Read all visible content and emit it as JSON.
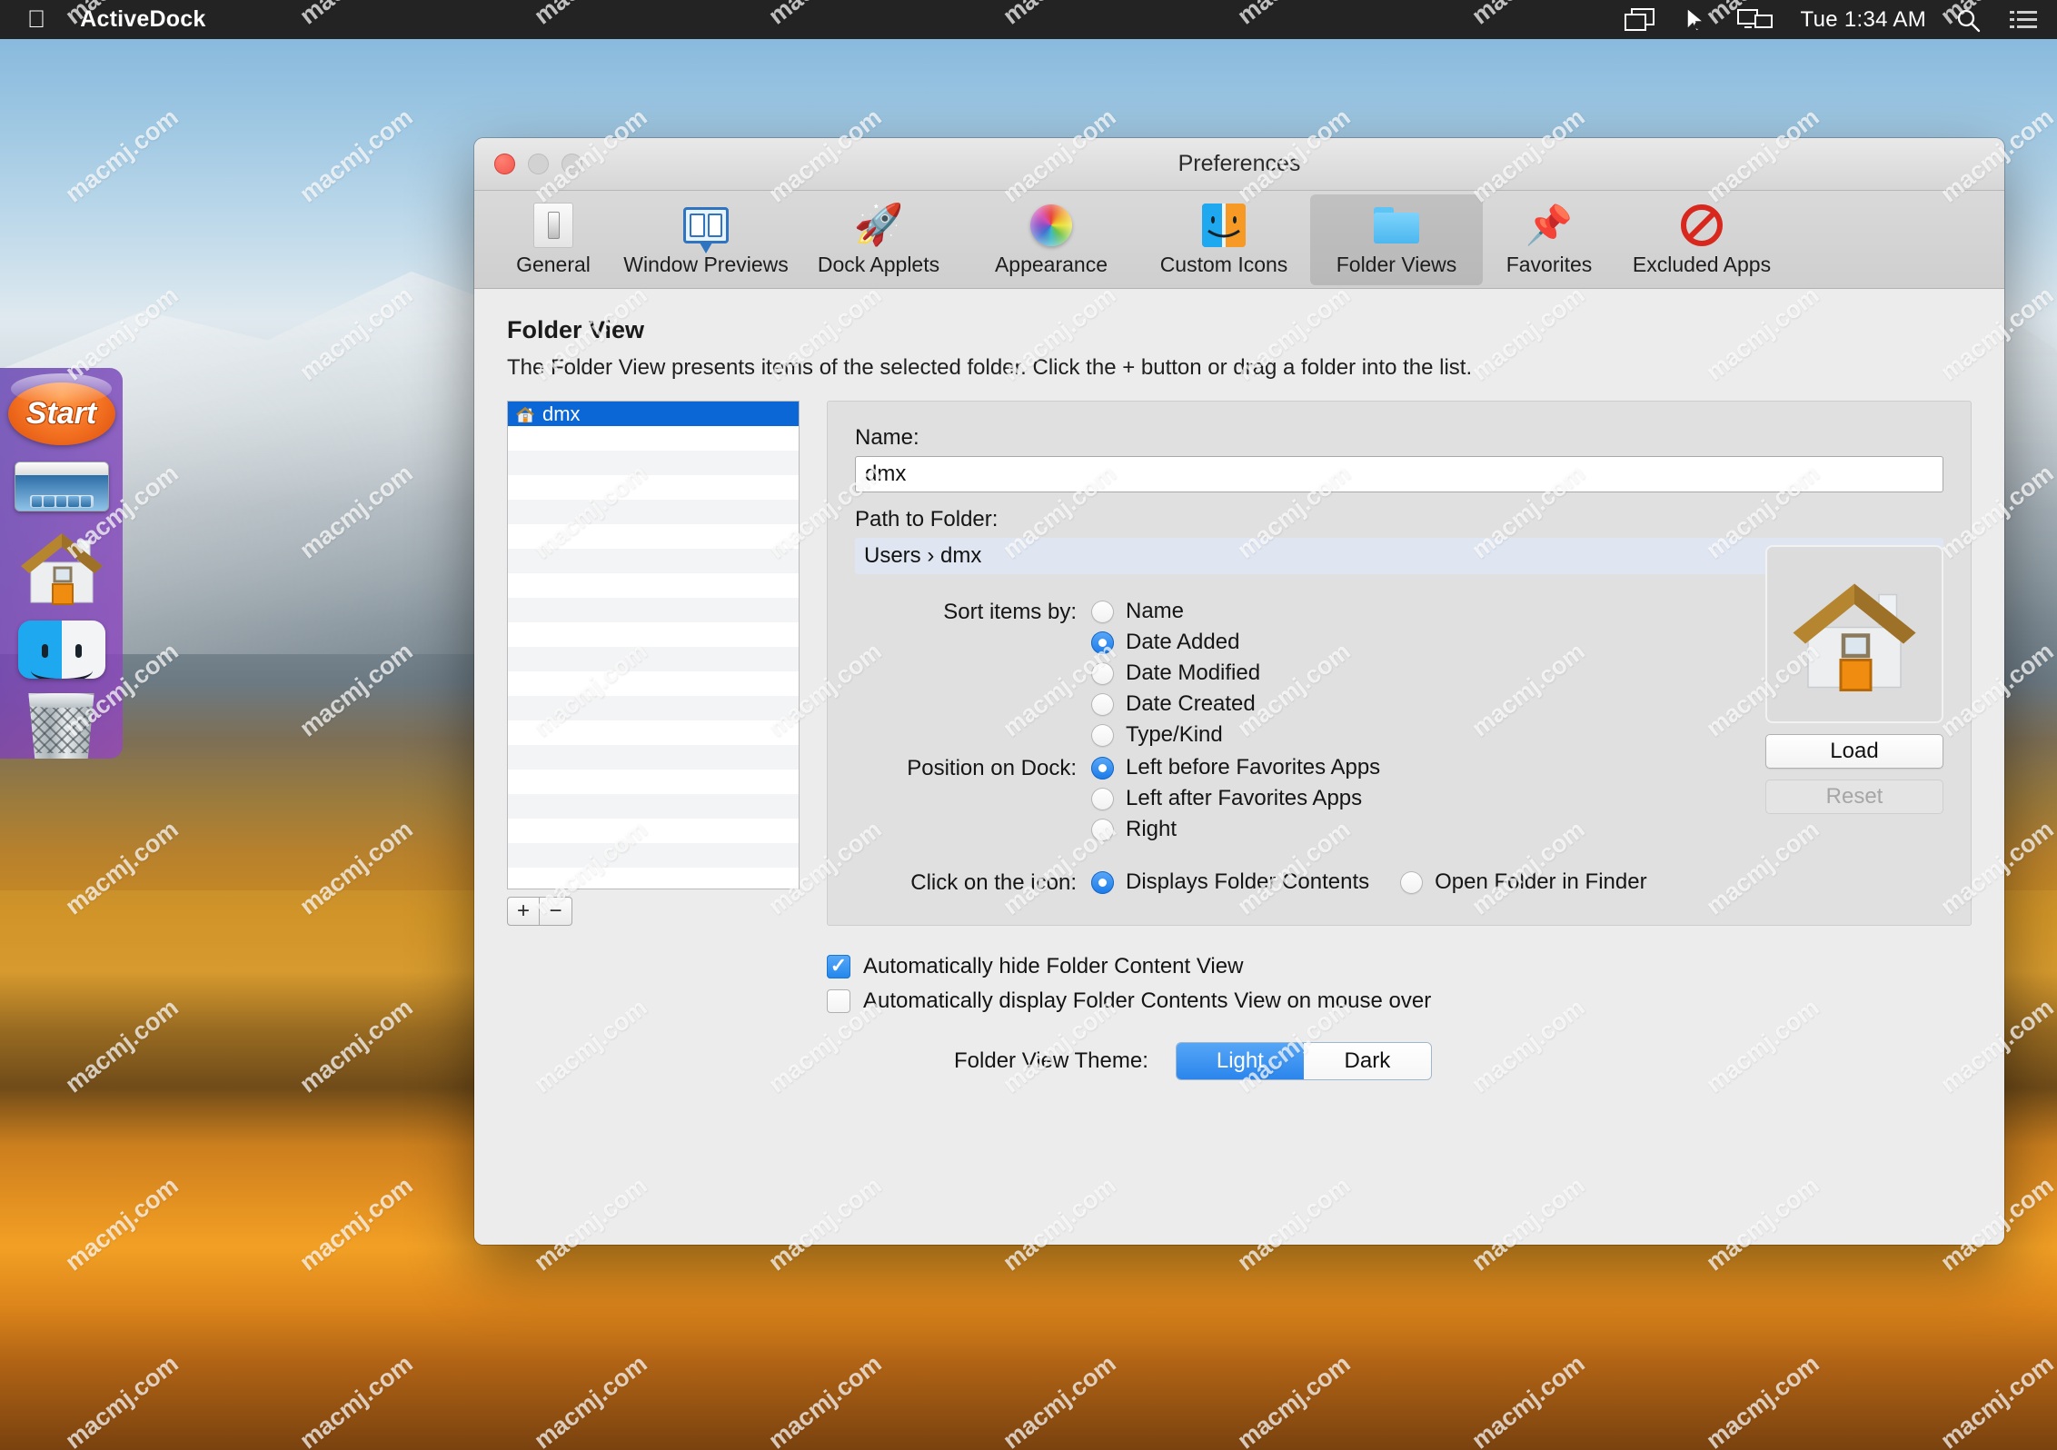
{
  "menubar": {
    "apple_glyph": "●",
    "app_title": "ActiveDock",
    "clock": "Tue 1:34 AM",
    "items": [
      {
        "name": "mission-control-icon",
        "label": ""
      },
      {
        "name": "cursor-icon",
        "label": ""
      },
      {
        "name": "display-icon",
        "label": ""
      },
      {
        "name": "search-icon",
        "label": ""
      },
      {
        "name": "notification-center-icon",
        "label": ""
      }
    ]
  },
  "dock": {
    "start_label": "Start",
    "items": [
      {
        "name": "start-button",
        "label": "Start"
      },
      {
        "name": "desktop-thumbnail-icon",
        "label": ""
      },
      {
        "name": "home-folder-icon",
        "label": ""
      },
      {
        "name": "finder-icon",
        "label": ""
      },
      {
        "name": "trash-icon",
        "label": ""
      }
    ]
  },
  "window": {
    "title": "Preferences",
    "traffic_lights": [
      "close",
      "minimize",
      "zoom"
    ]
  },
  "toolbar": {
    "items": [
      {
        "label": "General",
        "icon": "general-icon",
        "selected": false
      },
      {
        "label": "Window Previews",
        "icon": "window-previews-icon",
        "selected": false
      },
      {
        "label": "Dock Applets",
        "icon": "dock-applets-icon",
        "selected": false
      },
      {
        "label": "Appearance",
        "icon": "appearance-icon",
        "selected": false
      },
      {
        "label": "Custom Icons",
        "icon": "custom-icons-icon",
        "selected": false
      },
      {
        "label": "Folder Views",
        "icon": "folder-views-icon",
        "selected": true
      },
      {
        "label": "Favorites",
        "icon": "favorites-icon",
        "selected": false
      },
      {
        "label": "Excluded Apps",
        "icon": "excluded-apps-icon",
        "selected": false
      }
    ]
  },
  "section": {
    "title": "Folder View",
    "description": "The Folder View presents items of the selected folder. Click the + button or drag a folder into the list."
  },
  "folder_list": {
    "selected_index": 0,
    "rows": [
      {
        "label": "dmx",
        "icon": "home-folder-icon",
        "selected": true
      }
    ],
    "add_button": "+",
    "remove_button": "−"
  },
  "detail": {
    "name_label": "Name:",
    "name_value": "dmx",
    "path_label": "Path to Folder:",
    "path_value": "Users  ›  dmx",
    "sort_label": "Sort items by:",
    "sort_options": [
      {
        "label": "Name",
        "selected": false
      },
      {
        "label": "Date Added",
        "selected": true
      },
      {
        "label": "Date Modified",
        "selected": false
      },
      {
        "label": "Date Created",
        "selected": false
      },
      {
        "label": "Type/Kind",
        "selected": false
      }
    ],
    "position_label": "Position on Dock:",
    "position_options": [
      {
        "label": "Left before Favorites Apps",
        "selected": true
      },
      {
        "label": "Left after Favorites Apps",
        "selected": false
      },
      {
        "label": "Right",
        "selected": false
      }
    ],
    "click_label": "Click on the icon:",
    "click_options": [
      {
        "label": "Displays Folder Contents",
        "selected": true
      },
      {
        "label": "Open Folder in Finder",
        "selected": false
      }
    ],
    "preview_icon": "home-folder-icon",
    "load_button": "Load",
    "reset_button": "Reset",
    "reset_disabled": true
  },
  "bottom": {
    "checkboxes": [
      {
        "label": "Automatically hide Folder Content View",
        "checked": true
      },
      {
        "label": "Automatically display Folder Contents View on mouse over",
        "checked": false
      }
    ],
    "theme_label": "Folder View Theme:",
    "theme_options": [
      {
        "label": "Light",
        "selected": true
      },
      {
        "label": "Dark",
        "selected": false
      }
    ]
  },
  "colors": {
    "accent_blue": "#1b7ae8",
    "selection_blue": "#0b66d6",
    "window_bg": "#ececec",
    "detail_bg": "#e0e0e0",
    "menubar_bg": "#232323",
    "dock_purple": "#8a46c3",
    "close_red": "#f0534a"
  },
  "watermark": {
    "text": "macmj.com"
  }
}
